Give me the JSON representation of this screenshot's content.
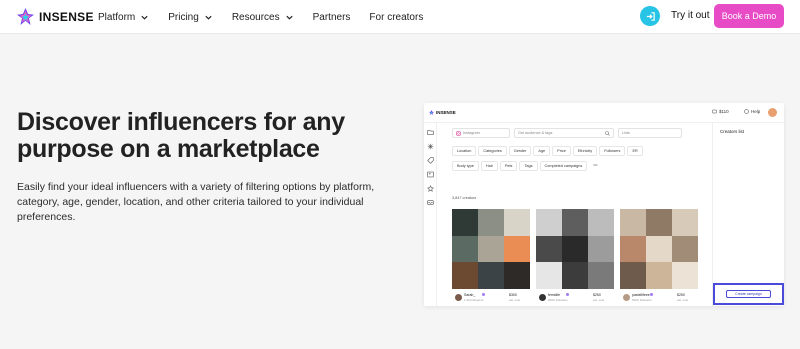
{
  "nav": {
    "brand": "INSENSE",
    "items": [
      {
        "label": "Platform",
        "has_dropdown": true
      },
      {
        "label": "Pricing",
        "has_dropdown": true
      },
      {
        "label": "Resources",
        "has_dropdown": true
      },
      {
        "label": "Partners",
        "has_dropdown": false
      },
      {
        "label": "For creators",
        "has_dropdown": false
      }
    ],
    "login_icon": "login-arrow-icon",
    "try_label": "Try it out",
    "demo_label": "Book a Demo",
    "colors": {
      "accent": "#e84bc6",
      "login": "#27c4e6"
    }
  },
  "hero": {
    "title_line1": "Discover influencers for any",
    "title_line2": "purpose on a marketplace",
    "description": "Easily find your ideal influencers with a variety of filtering options by platform, category, age, gender, location, and other criteria tailored to your individual preferences."
  },
  "app": {
    "brand": "INSENSE",
    "balance": "$110",
    "help": "Help",
    "sidebar_icons": [
      "folder-icon",
      "sparkle-icon",
      "tag-icon",
      "image-icon",
      "star-icon",
      "inbox-icon"
    ],
    "search": {
      "platform": "Instagram",
      "search_placeholder": "Get audience & tags",
      "sort": "Lists"
    },
    "filters_row1": [
      "Location",
      "Categories",
      "Gender",
      "Age",
      "Price",
      "Ethnicity",
      "Followers",
      "ER"
    ],
    "filters_row2": [
      "Body type",
      "Hair",
      "Pets",
      "Tags",
      "Completed campaigns"
    ],
    "filters_more": "•••",
    "count_label": "3,847 creators",
    "right_panel_title": "Creators list",
    "create_label": "Create campaign",
    "creators": [
      {
        "name": "Sarah_",
        "meta": "1.2M followers",
        "price": "$300",
        "price_meta": "est. cost"
      },
      {
        "name": "femslife",
        "meta": "840K followers",
        "price": "$250",
        "price_meta": "est. cost"
      },
      {
        "name": "pastellifeee",
        "meta": "520K followers",
        "price": "$250",
        "price_meta": "est. cost"
      }
    ]
  }
}
